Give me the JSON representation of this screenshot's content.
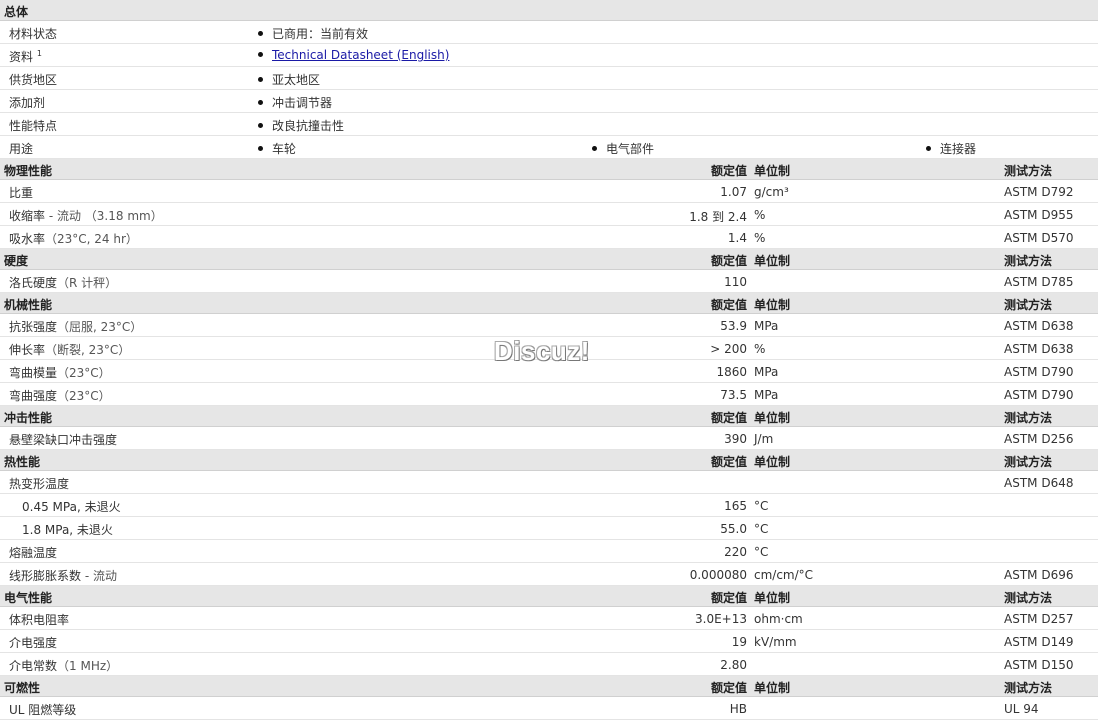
{
  "general": {
    "title": "总体",
    "rows": [
      {
        "label": "材料状态",
        "items": [
          "已商用：当前有效"
        ]
      },
      {
        "label": "资料",
        "sup": "1",
        "items": [
          "Technical Datasheet (English)"
        ],
        "link": true
      },
      {
        "label": "供货地区",
        "items": [
          "亚太地区"
        ]
      },
      {
        "label": "添加剂",
        "items": [
          "冲击调节器"
        ]
      },
      {
        "label": "性能特点",
        "items": [
          "改良抗撞击性"
        ]
      },
      {
        "label": "用途",
        "items": [
          "车轮",
          "电气部件",
          "连接器"
        ]
      }
    ]
  },
  "column_headers": {
    "value": "额定值",
    "unit": "单位制",
    "method": "测试方法"
  },
  "sections": [
    {
      "title": "物理性能",
      "rows": [
        {
          "label": "比重",
          "cond": "",
          "value": "1.07",
          "unit": "g/cm³",
          "method": "ASTM D792"
        },
        {
          "label": "收缩率",
          "cond": " - 流动 （3.18 mm）",
          "value": "1.8 到  2.4",
          "unit": "%",
          "method": "ASTM D955"
        },
        {
          "label": "吸水率",
          "cond": "（23°C, 24 hr）",
          "value": "1.4",
          "unit": "%",
          "method": "ASTM D570"
        }
      ]
    },
    {
      "title": "硬度",
      "rows": [
        {
          "label": "洛氏硬度",
          "cond": "（R 计秤）",
          "value": "110",
          "unit": "",
          "method": "ASTM D785"
        }
      ]
    },
    {
      "title": "机械性能",
      "rows": [
        {
          "label": "抗张强度",
          "cond": "（屈服, 23°C）",
          "value": "53.9",
          "unit": "MPa",
          "method": "ASTM D638"
        },
        {
          "label": "伸长率",
          "cond": "（断裂, 23°C）",
          "value": "> 200",
          "unit": "%",
          "method": "ASTM D638"
        },
        {
          "label": "弯曲模量",
          "cond": "（23°C）",
          "value": "1860",
          "unit": "MPa",
          "method": "ASTM D790"
        },
        {
          "label": "弯曲强度",
          "cond": "（23°C）",
          "value": "73.5",
          "unit": "MPa",
          "method": "ASTM D790"
        }
      ]
    },
    {
      "title": "冲击性能",
      "rows": [
        {
          "label": "悬壁梁缺口冲击强度",
          "cond": "",
          "value": "390",
          "unit": "J/m",
          "method": "ASTM D256"
        }
      ]
    },
    {
      "title": "热性能",
      "rows": [
        {
          "label": "热变形温度",
          "cond": "",
          "value": "",
          "unit": "",
          "method": "ASTM D648"
        },
        {
          "label": "0.45 MPa, 未退火",
          "cond": "",
          "value": "165",
          "unit": "°C",
          "method": "",
          "indent": true
        },
        {
          "label": "1.8 MPa, 未退火",
          "cond": "",
          "value": "55.0",
          "unit": "°C",
          "method": "",
          "indent": true
        },
        {
          "label": "熔融温度",
          "cond": "",
          "value": "220",
          "unit": "°C",
          "method": ""
        },
        {
          "label": "线形膨胀系数",
          "cond": " - 流动",
          "value": "0.000080",
          "unit": "cm/cm/°C",
          "method": "ASTM D696"
        }
      ]
    },
    {
      "title": "电气性能",
      "rows": [
        {
          "label": "体积电阻率",
          "cond": "",
          "value": "3.0E+13",
          "unit": "ohm·cm",
          "method": "ASTM D257"
        },
        {
          "label": "介电强度",
          "cond": "",
          "value": "19",
          "unit": "kV/mm",
          "method": "ASTM D149"
        },
        {
          "label": "介电常数",
          "cond": "（1 MHz）",
          "value": "2.80",
          "unit": "",
          "method": "ASTM D150"
        }
      ]
    },
    {
      "title": "可燃性",
      "rows": [
        {
          "label": "UL 阻燃等级",
          "cond": "",
          "value": "HB",
          "unit": "",
          "method": "UL 94"
        }
      ]
    }
  ],
  "watermark": "Discuz!"
}
